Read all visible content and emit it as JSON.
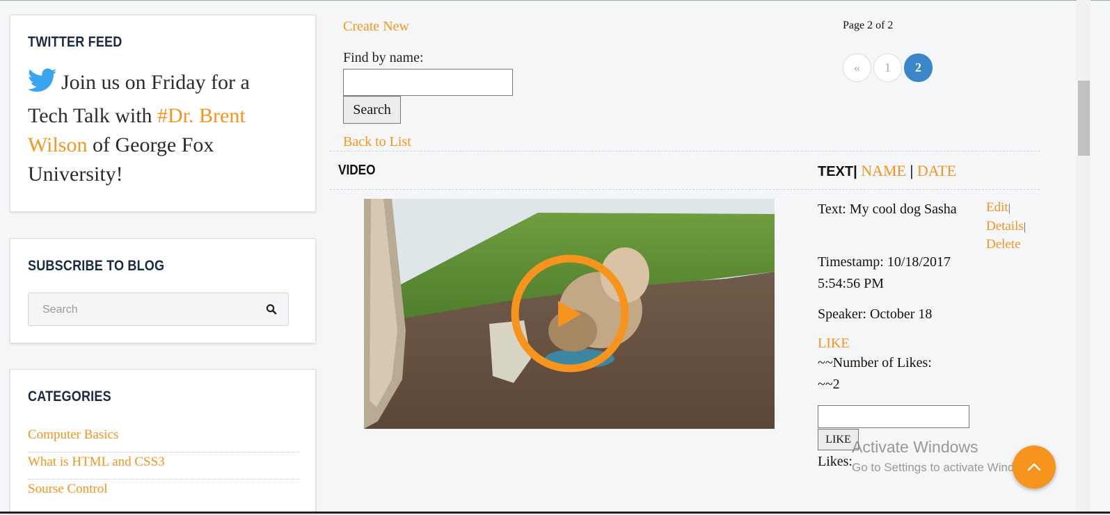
{
  "colors": {
    "accent": "#f7941d",
    "pager_active": "#3a86c8",
    "heading": "#1b2a44"
  },
  "sidebar": {
    "twitter": {
      "title": "TWITTER FEED",
      "icon": "twitter-bird-icon",
      "text_before": "Join us on Friday for a Tech Talk with ",
      "hashtag": "#Dr. Brent Wilson",
      "text_after": " of George Fox University!"
    },
    "subscribe": {
      "title": "SUBSCRIBE TO BLOG",
      "search_placeholder": "Search",
      "icon": "search-icon"
    },
    "categories": {
      "title": "CATEGORIES",
      "items": [
        "Computer Basics",
        "What is HTML and CSS3",
        "Sourse Control"
      ]
    }
  },
  "main": {
    "create_new": "Create New",
    "find_label": "Find by name:",
    "find_value": "",
    "search_button": "Search",
    "back_to_list": "Back to List",
    "page_info": "Page 2 of 2",
    "pager": {
      "prev": "«",
      "pages": [
        "1",
        "2"
      ],
      "current": "2"
    },
    "table": {
      "col_video": "VIDEO",
      "col_text": "TEXT|",
      "sort_name": "NAME",
      "sort_sep": "|",
      "sort_date": "DATE"
    },
    "row": {
      "video_icon": "play-button-icon",
      "text": "Text: My cool dog Sasha",
      "timestamp": "Timestamp: 10/18/2017 5:54:56 PM",
      "speaker": "Speaker: October 18",
      "like_link": "LIKE",
      "likes_label": "~~Number of Likes:",
      "likes_value": "~~2",
      "like_input_value": "",
      "like_button": "LIKE",
      "likes_footer": "Likes:",
      "edit": "Edit",
      "details": "Details",
      "delete": "Delete",
      "sep": "|"
    }
  },
  "watermark": {
    "line1": "Activate Windows",
    "line2": "Go to Settings to activate Windows."
  },
  "back_to_top_icon": "chevron-up-icon"
}
